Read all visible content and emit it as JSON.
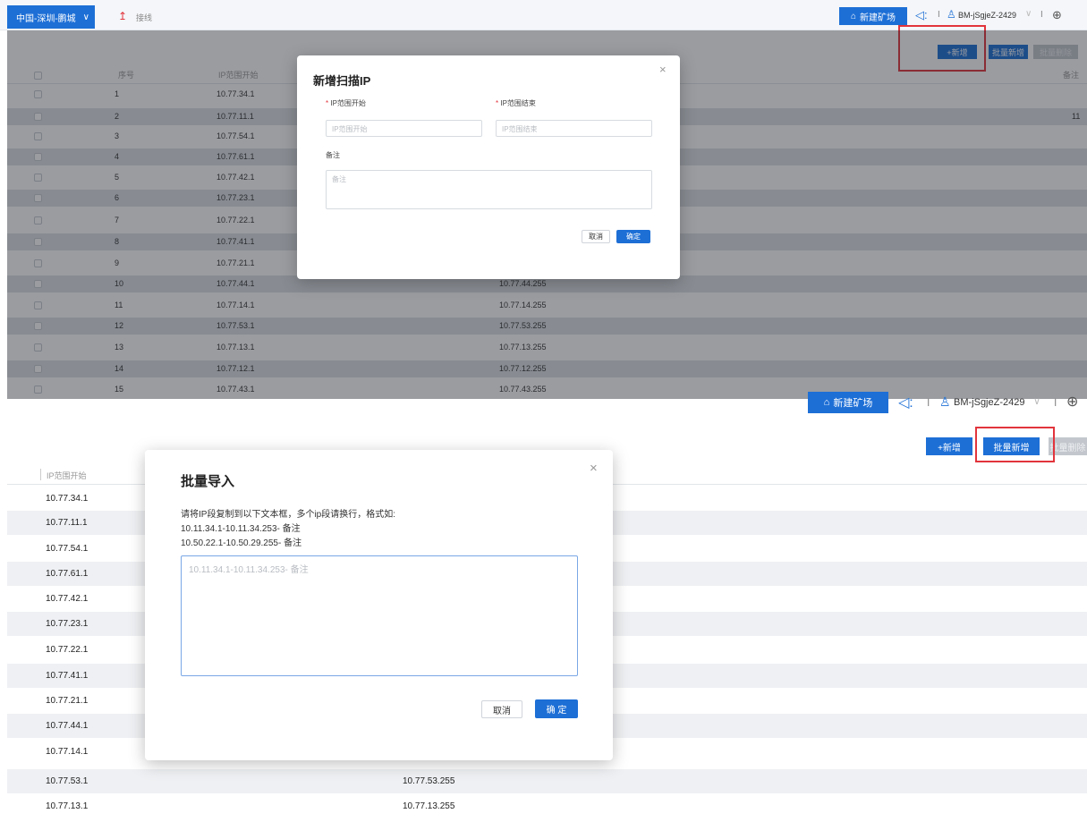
{
  "top": {
    "region": "中国-深圳-鹏城",
    "nav_label": "接线",
    "new_factory": "新建矿场",
    "username": "BM-jSgjeZ-2429",
    "sep": "I"
  },
  "toolbar": {
    "add": "+新增",
    "batch_add": "批量新增",
    "batch_delete": "批量删除"
  },
  "table1": {
    "headers": {
      "index": "序号",
      "ip_start": "IP范围开始",
      "remark": "备注"
    },
    "rows": [
      {
        "idx": "1",
        "start": "10.77.34.1",
        "end": ""
      },
      {
        "idx": "2",
        "start": "10.77.11.1",
        "end": ""
      },
      {
        "idx": "3",
        "start": "10.77.54.1",
        "end": ""
      },
      {
        "idx": "4",
        "start": "10.77.61.1",
        "end": ""
      },
      {
        "idx": "5",
        "start": "10.77.42.1",
        "end": ""
      },
      {
        "idx": "6",
        "start": "10.77.23.1",
        "end": ""
      },
      {
        "idx": "7",
        "start": "10.77.22.1",
        "end": ""
      },
      {
        "idx": "8",
        "start": "10.77.41.1",
        "end": ""
      },
      {
        "idx": "9",
        "start": "10.77.21.1",
        "end": ""
      },
      {
        "idx": "10",
        "start": "10.77.44.1",
        "end": "10.77.44.255"
      },
      {
        "idx": "11",
        "start": "10.77.14.1",
        "end": "10.77.14.255"
      },
      {
        "idx": "12",
        "start": "10.77.53.1",
        "end": "10.77.53.255"
      },
      {
        "idx": "13",
        "start": "10.77.13.1",
        "end": "10.77.13.255"
      },
      {
        "idx": "14",
        "start": "10.77.12.1",
        "end": "10.77.12.255"
      },
      {
        "idx": "15",
        "start": "10.77.43.1",
        "end": "10.77.43.255"
      }
    ],
    "row2_remark": "11"
  },
  "dialog1": {
    "title": "新增扫描IP",
    "start_label": "IP范围开始",
    "end_label": "IP范围结束",
    "start_placeholder": "IP范围开始",
    "end_placeholder": "IP范围结束",
    "remark_label": "备注",
    "remark_placeholder": "备注",
    "cancel": "取消",
    "confirm": "确定"
  },
  "table2": {
    "header": "IP范围开始",
    "rows": [
      {
        "start": "10.77.34.1",
        "end": ""
      },
      {
        "start": "10.77.11.1",
        "end": ""
      },
      {
        "start": "10.77.54.1",
        "end": ""
      },
      {
        "start": "10.77.61.1",
        "end": ""
      },
      {
        "start": "10.77.42.1",
        "end": ""
      },
      {
        "start": "10.77.23.1",
        "end": ""
      },
      {
        "start": "10.77.22.1",
        "end": ""
      },
      {
        "start": "10.77.41.1",
        "end": ""
      },
      {
        "start": "10.77.21.1",
        "end": ""
      },
      {
        "start": "10.77.44.1",
        "end": ""
      },
      {
        "start": "10.77.14.1",
        "end": ""
      },
      {
        "start": "10.77.53.1",
        "end": "10.77.53.255"
      },
      {
        "start": "10.77.13.1",
        "end": "10.77.13.255"
      }
    ]
  },
  "dialog2": {
    "title": "批量导入",
    "instruction": "请将IP段复制到以下文本框，多个ip段请换行，格式如:",
    "example1": "10.11.34.1-10.11.34.253- 备注",
    "example2": "10.50.22.1-10.50.29.255- 备注",
    "placeholder": "10.11.34.1-10.11.34.253- 备注",
    "cancel": "取消",
    "confirm": "确 定"
  },
  "colors": {
    "primary": "#1d6fd6",
    "highlight": "#e2343c",
    "alt_row": "#dfe2e6"
  }
}
